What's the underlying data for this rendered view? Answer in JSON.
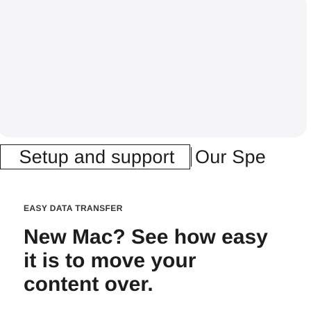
{
  "tabs": {
    "active_label": "Setup and support",
    "next_label": "Our Spe"
  },
  "card": {
    "eyebrow": "EASY DATA TRANSFER",
    "headline": "New Mac? See how easy it is to move your content over."
  },
  "colors": {
    "hero_background": "#f5f5f7",
    "text": "#1d1d1f",
    "page_background": "#ffffff"
  }
}
